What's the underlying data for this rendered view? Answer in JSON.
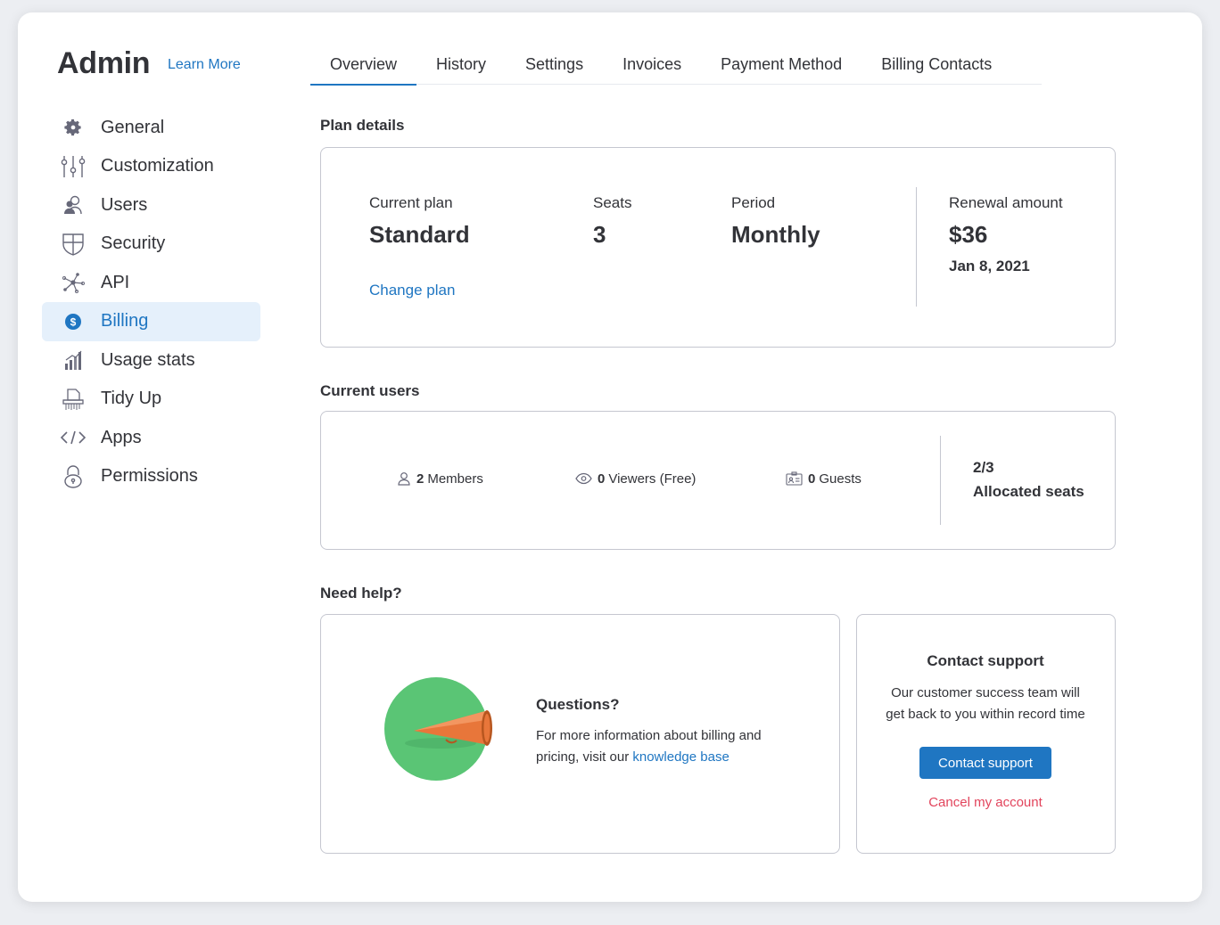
{
  "sidebar": {
    "title": "Admin",
    "learn_more": "Learn More",
    "items": [
      {
        "label": "General",
        "icon": "gear-icon"
      },
      {
        "label": "Customization",
        "icon": "sliders-icon"
      },
      {
        "label": "Users",
        "icon": "users-icon"
      },
      {
        "label": "Security",
        "icon": "shield-icon"
      },
      {
        "label": "API",
        "icon": "api-icon"
      },
      {
        "label": "Billing",
        "icon": "dollar-icon",
        "active": true
      },
      {
        "label": "Usage stats",
        "icon": "usage-stats-icon"
      },
      {
        "label": "Tidy Up",
        "icon": "shredder-icon"
      },
      {
        "label": "Apps",
        "icon": "code-icon"
      },
      {
        "label": "Permissions",
        "icon": "lock-icon"
      }
    ]
  },
  "tabs": [
    "Overview",
    "History",
    "Settings",
    "Invoices",
    "Payment Method",
    "Billing Contacts"
  ],
  "active_tab": "Overview",
  "plan_details": {
    "heading": "Plan details",
    "current_plan_label": "Current plan",
    "current_plan_value": "Standard",
    "seats_label": "Seats",
    "seats_value": "3",
    "period_label": "Period",
    "period_value": "Monthly",
    "change_plan": "Change plan",
    "renewal_label": "Renewal amount",
    "renewal_value": "$36",
    "renewal_date": "Jan 8, 2021"
  },
  "current_users": {
    "heading": "Current users",
    "members_count": "2",
    "members_label": "Members",
    "viewers_count": "0",
    "viewers_label": "Viewers (Free)",
    "guests_count": "0",
    "guests_label": "Guests",
    "allocated_ratio": "2/3",
    "allocated_label": "Allocated seats"
  },
  "help": {
    "heading": "Need help?",
    "questions_title": "Questions?",
    "questions_text": "For more information about billing and pricing, visit our",
    "knowledge_base": "knowledge base",
    "contact_title": "Contact support",
    "contact_text_1": "Our customer success team will",
    "contact_text_2": "get back to you within record time",
    "contact_button": "Contact support",
    "cancel_account": "Cancel my account"
  },
  "colors": {
    "accent": "#1f76c2",
    "active_bg": "#e5f0fb",
    "danger": "#e2445c",
    "illustration_green": "#5ac575",
    "megaphone_orange": "#e8763a"
  }
}
